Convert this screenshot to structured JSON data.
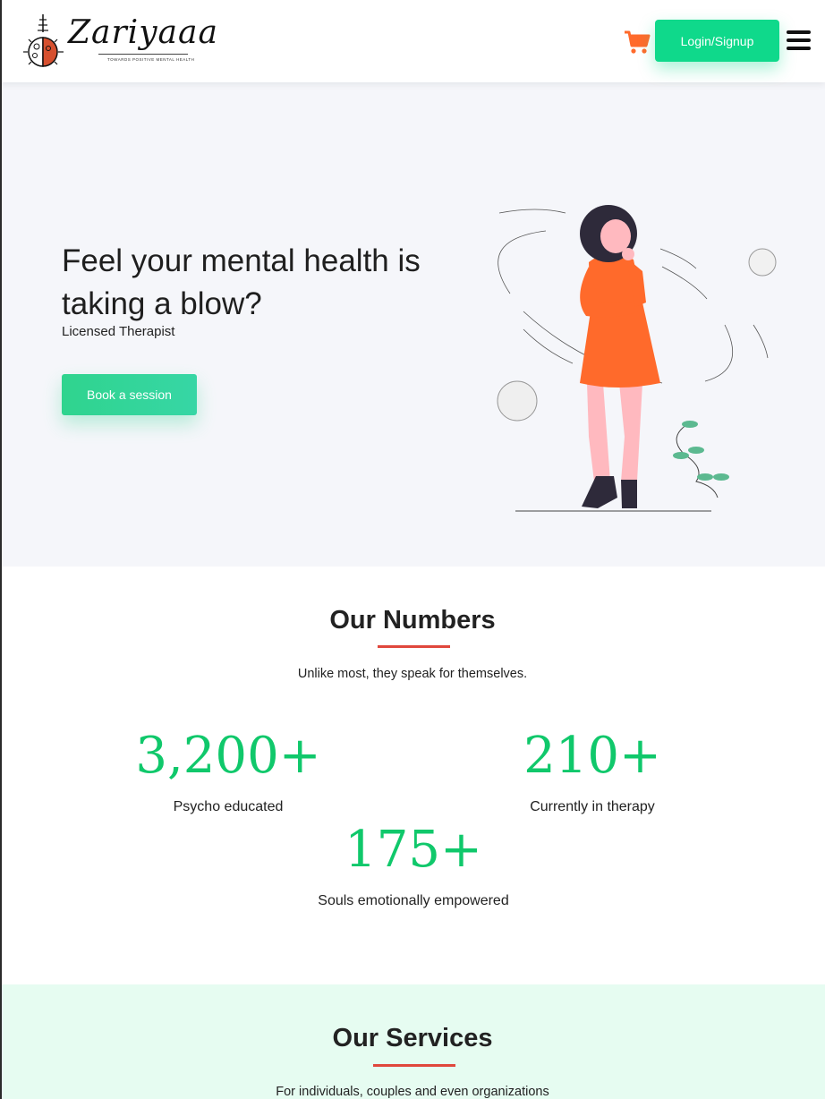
{
  "header": {
    "logo_text": "Zariyaaa",
    "logo_tagline": "TOWARDS POSITIVE MENTAL HEALTH",
    "login_label": "Login/Signup",
    "cart_icon": "cart-icon",
    "menu_icon": "hamburger-menu-icon"
  },
  "hero": {
    "title": "Feel your mental health is taking a blow?",
    "subtitle": "Licensed Therapist",
    "cta_label": "Book a session"
  },
  "numbers": {
    "title": "Our Numbers",
    "subtitle": "Unlike most, they speak for themselves.",
    "stats": [
      {
        "value": "3,200+",
        "label": "Psycho educated"
      },
      {
        "value": "210+",
        "label": "Currently in therapy"
      },
      {
        "value": "175+",
        "label": "Souls emotionally empowered"
      }
    ]
  },
  "services": {
    "title": "Our Services",
    "subtitle": "For individuals, couples and even organizations"
  },
  "colors": {
    "brand_green": "#0fd98b",
    "accent_orange": "#ff6a2b",
    "stat_green": "#10c86b",
    "underline_red": "#e0473c",
    "hero_bg": "#f5f6fa",
    "services_bg": "#e6fcf1"
  }
}
